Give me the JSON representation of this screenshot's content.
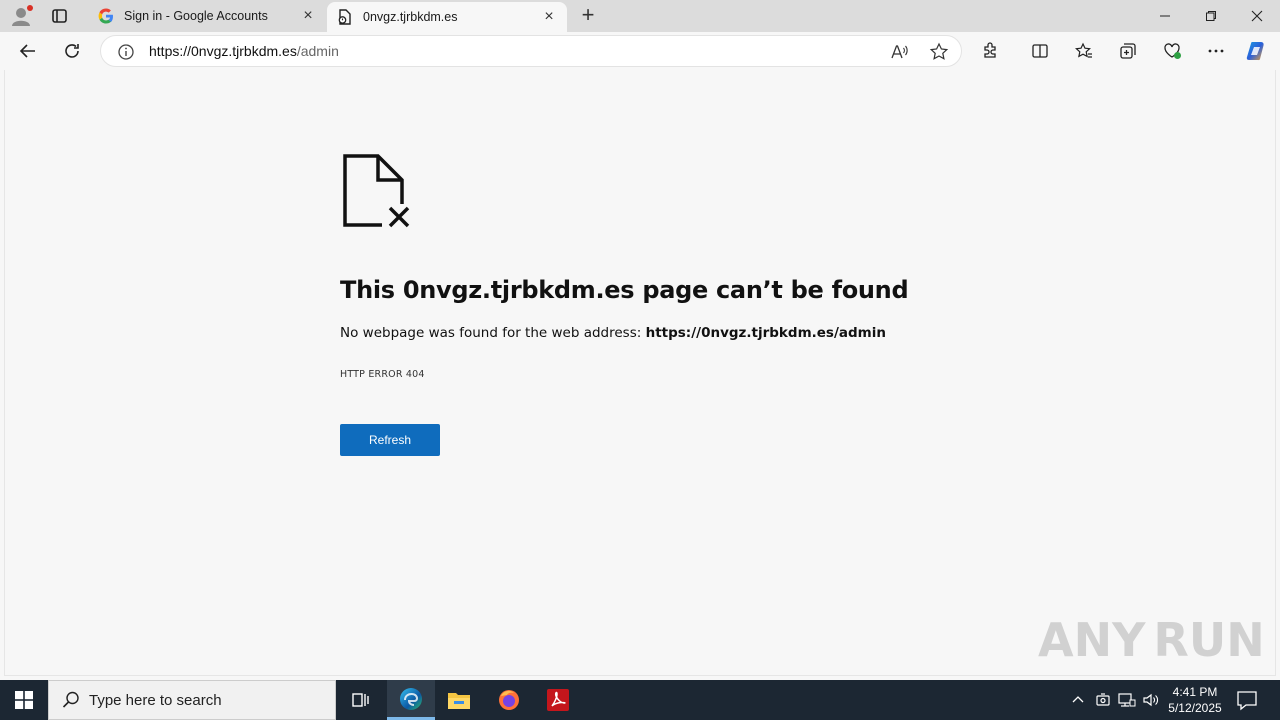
{
  "tabs": [
    {
      "title": "Sign in - Google Accounts",
      "active": false
    },
    {
      "title": "0nvgz.tjrbkdm.es",
      "active": true
    }
  ],
  "address": {
    "url_host": "https://0nvgz.tjrbkdm.es",
    "url_path": "/admin",
    "read_aloud_label": "A⁾"
  },
  "error": {
    "title": "This 0nvgz.tjrbkdm.es page can’t be found",
    "desc_prefix": "No webpage was found for the web address: ",
    "desc_url": "https://0nvgz.tjrbkdm.es/admin",
    "code": "HTTP ERROR 404",
    "refresh_label": "Refresh"
  },
  "watermark": {
    "left": "ANY",
    "right": "RUN"
  },
  "taskbar": {
    "search_placeholder": "Type here to search",
    "time": "4:41 PM",
    "date": "5/12/2025"
  },
  "colors": {
    "accent": "#0f6cbd",
    "taskbar": "#1c2733",
    "tabstrip": "#dcdcdc"
  },
  "icons": [
    "profile-icon",
    "workspaces-icon",
    "google-icon",
    "page-error-icon",
    "close-icon",
    "plus-icon",
    "minimize-icon",
    "restore-icon",
    "back-icon",
    "reload-icon",
    "info-icon",
    "favorite-star-icon",
    "extensions-icon",
    "split-screen-icon",
    "favorites-icon",
    "collections-icon",
    "browser-essentials-icon",
    "more-icon",
    "copilot-icon",
    "windows-icon",
    "search-icon",
    "task-view-icon",
    "edge-icon",
    "file-explorer-icon",
    "firefox-icon",
    "acrobat-icon",
    "chevron-up-icon",
    "meet-icon",
    "network-icon",
    "volume-icon",
    "notification-icon"
  ]
}
